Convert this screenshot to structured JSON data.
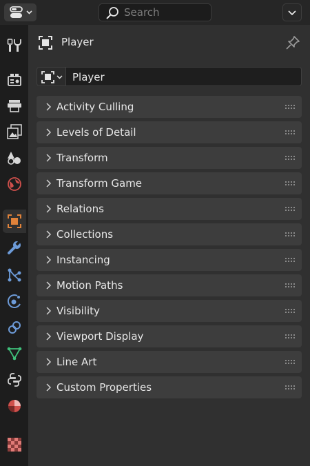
{
  "header": {
    "search_placeholder": "Search"
  },
  "tabs": [
    {
      "name": "tool-tab",
      "icon": "tool-icon",
      "active": false
    },
    {
      "name": "render-tab",
      "icon": "render-icon",
      "active": false
    },
    {
      "name": "output-tab",
      "icon": "output-icon",
      "active": false
    },
    {
      "name": "view-layer-tab",
      "icon": "view-layer-icon",
      "active": false
    },
    {
      "name": "scene-tab",
      "icon": "scene-icon",
      "active": false
    },
    {
      "name": "world-tab",
      "icon": "world-icon",
      "active": false
    },
    {
      "name": "object-tab",
      "icon": "object-icon",
      "active": true
    },
    {
      "name": "modifier-tab",
      "icon": "wrench-icon",
      "active": false
    },
    {
      "name": "particles-tab",
      "icon": "particles-icon",
      "active": false
    },
    {
      "name": "physics-tab",
      "icon": "physics-icon",
      "active": false
    },
    {
      "name": "constraints-tab",
      "icon": "constraints-icon",
      "active": false
    },
    {
      "name": "data-tab",
      "icon": "mesh-data-icon",
      "active": false
    },
    {
      "name": "script-tab",
      "icon": "python-icon",
      "active": false
    },
    {
      "name": "material-tab",
      "icon": "material-icon",
      "active": false
    },
    {
      "name": "texture-tab",
      "icon": "texture-icon",
      "active": false
    }
  ],
  "properties": {
    "title": "Player",
    "object_name": "Player",
    "panels": [
      "Activity Culling",
      "Levels of Detail",
      "Transform",
      "Transform Game",
      "Relations",
      "Collections",
      "Instancing",
      "Motion Paths",
      "Visibility",
      "Viewport Display",
      "Line Art",
      "Custom Properties"
    ]
  },
  "colors": {
    "accent_orange": "#e0823a",
    "wrench_blue": "#6d9bd8",
    "green_data": "#3fbf7a",
    "red_world": "#d0504c"
  }
}
